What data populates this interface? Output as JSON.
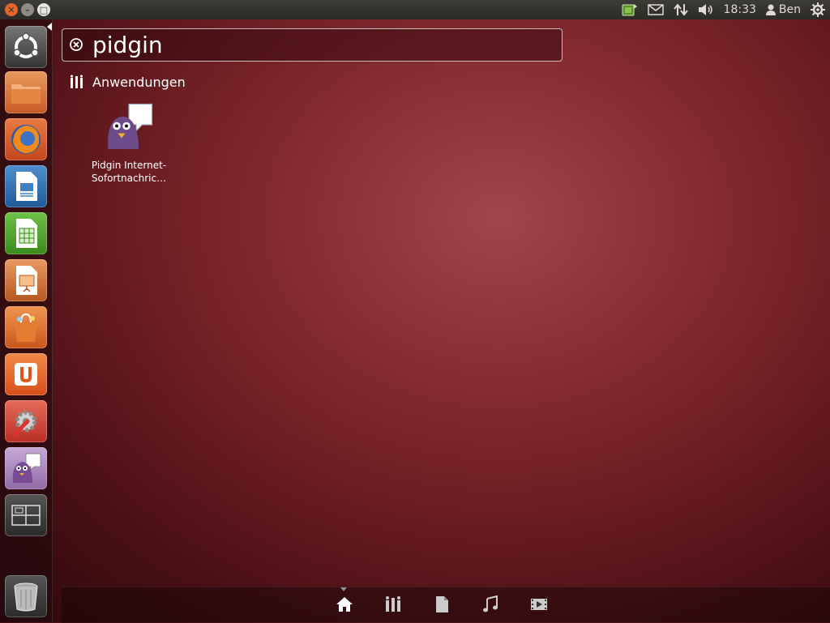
{
  "top_panel": {
    "time": "18:33",
    "user": "Ben",
    "icons": [
      "update-manager-icon",
      "mail-icon",
      "network-icon",
      "volume-icon",
      "user-icon",
      "session-gear-icon"
    ]
  },
  "window_controls": [
    "close-icon",
    "minimize-icon",
    "maximize-icon"
  ],
  "launcher": {
    "items": [
      "dash-home",
      "files",
      "firefox",
      "libreoffice-writer",
      "libreoffice-calc",
      "libreoffice-impress",
      "software-center",
      "ubuntu-one",
      "system-settings",
      "pidgin",
      "workspace-switcher",
      "trash"
    ]
  },
  "search": {
    "value": "pidgin"
  },
  "results": {
    "category": "Anwendungen",
    "items": [
      {
        "label": "Pidgin Internet-Sofortnachric…"
      }
    ]
  },
  "lenses": [
    "home-lens",
    "applications-lens",
    "files-lens",
    "music-lens",
    "video-lens"
  ],
  "colors": {
    "accent": "#e8642c",
    "panel": "#3c3b37"
  }
}
